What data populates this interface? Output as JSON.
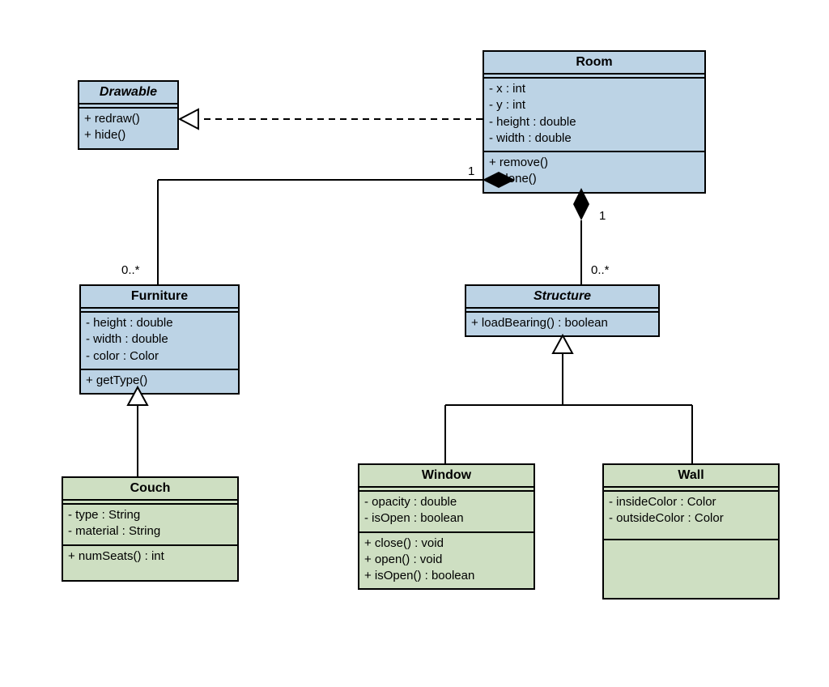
{
  "classes": {
    "drawable": {
      "name": "Drawable",
      "methods": [
        "+ redraw()",
        "+ hide()"
      ]
    },
    "room": {
      "name": "Room",
      "attrs": [
        "- x : int",
        "- y : int",
        "- height : double",
        "- width : double"
      ],
      "methods": [
        "+ remove()",
        "+ clone()"
      ]
    },
    "furniture": {
      "name": "Furniture",
      "attrs": [
        "- height : double",
        "- width : double",
        "- color : Color"
      ],
      "methods": [
        "+ getType()"
      ]
    },
    "structure": {
      "name": "Structure",
      "methods": [
        "+ loadBearing() : boolean"
      ]
    },
    "couch": {
      "name": "Couch",
      "attrs": [
        "- type : String",
        "- material : String"
      ],
      "methods": [
        "+ numSeats() : int"
      ]
    },
    "window": {
      "name": "Window",
      "attrs": [
        "- opacity : double",
        "- isOpen : boolean"
      ],
      "methods": [
        "+ close() : void",
        "+ open() : void",
        "+ isOpen() : boolean"
      ]
    },
    "wall": {
      "name": "Wall",
      "attrs": [
        "- insideColor : Color",
        "- outsideColor : Color"
      ]
    }
  },
  "mult": {
    "roomFurniture1": "1",
    "roomFurniture0": "0..*",
    "roomStructure1": "1",
    "roomStructure0": "0..*"
  },
  "chart_data": {
    "type": "uml_class_diagram",
    "classes": [
      {
        "name": "Drawable",
        "stereotype": "interface",
        "attributes": [],
        "operations": [
          "redraw()",
          "hide()"
        ]
      },
      {
        "name": "Room",
        "attributes": [
          "x:int",
          "y:int",
          "height:double",
          "width:double"
        ],
        "operations": [
          "remove()",
          "clone()"
        ]
      },
      {
        "name": "Furniture",
        "attributes": [
          "height:double",
          "width:double",
          "color:Color"
        ],
        "operations": [
          "getType()"
        ]
      },
      {
        "name": "Structure",
        "stereotype": "abstract",
        "attributes": [],
        "operations": [
          "loadBearing():boolean"
        ]
      },
      {
        "name": "Couch",
        "attributes": [
          "type:String",
          "material:String"
        ],
        "operations": [
          "numSeats():int"
        ]
      },
      {
        "name": "Window",
        "attributes": [
          "opacity:double",
          "isOpen:boolean"
        ],
        "operations": [
          "close():void",
          "open():void",
          "isOpen():boolean"
        ]
      },
      {
        "name": "Wall",
        "attributes": [
          "insideColor:Color",
          "outsideColor:Color"
        ],
        "operations": []
      }
    ],
    "relationships": [
      {
        "from": "Room",
        "to": "Drawable",
        "type": "realization"
      },
      {
        "from": "Room",
        "to": "Furniture",
        "type": "composition",
        "from_mult": "1",
        "to_mult": "0..*"
      },
      {
        "from": "Room",
        "to": "Structure",
        "type": "composition",
        "from_mult": "1",
        "to_mult": "0..*"
      },
      {
        "from": "Couch",
        "to": "Furniture",
        "type": "generalization"
      },
      {
        "from": "Window",
        "to": "Structure",
        "type": "generalization"
      },
      {
        "from": "Wall",
        "to": "Structure",
        "type": "generalization"
      }
    ]
  }
}
